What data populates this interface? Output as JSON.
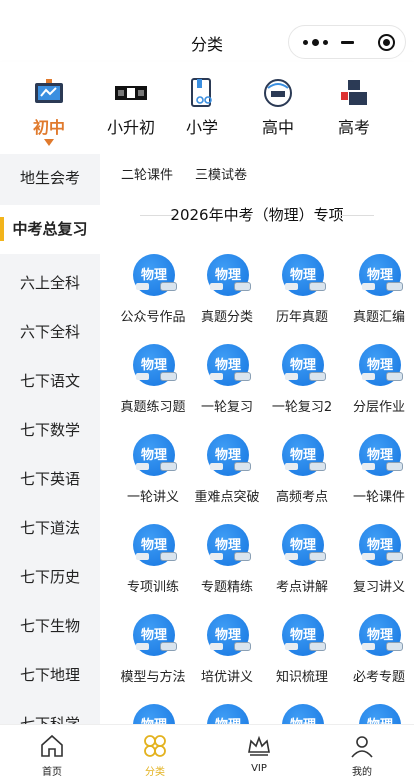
{
  "window": {
    "title": "分类"
  },
  "levels": [
    {
      "label": "初中",
      "icon": "blackboard-icon",
      "active": true
    },
    {
      "label": "小升初",
      "icon": "xiaoshengchu-logo-icon",
      "active": false
    },
    {
      "label": "小学",
      "icon": "book-glasses-icon",
      "active": false
    },
    {
      "label": "高中",
      "icon": "gaozhong-circle-icon",
      "active": false
    },
    {
      "label": "高考",
      "icon": "gaokao-logo-icon",
      "active": false
    }
  ],
  "sidebar": {
    "items": [
      {
        "label": "地生会考",
        "active": false
      },
      {
        "label": "中考总复习",
        "active": true
      },
      {
        "label": "六上全科",
        "active": false
      },
      {
        "label": "六下全科",
        "active": false
      },
      {
        "label": "七下语文",
        "active": false
      },
      {
        "label": "七下数学",
        "active": false
      },
      {
        "label": "七下英语",
        "active": false
      },
      {
        "label": "七下道法",
        "active": false
      },
      {
        "label": "七下历史",
        "active": false
      },
      {
        "label": "七下生物",
        "active": false
      },
      {
        "label": "七下地理",
        "active": false
      },
      {
        "label": "七下科学",
        "active": false
      }
    ]
  },
  "main": {
    "previous_items": [
      "二轮课件",
      "三模试卷"
    ],
    "section_title": "2026年中考（物理）专项",
    "badge_text": "物理",
    "items": [
      "公众号作品",
      "真题分类",
      "历年真题",
      "真题汇编",
      "真题练习题",
      "一轮复习",
      "一轮复习2",
      "分层作业",
      "一轮讲义",
      "重难点突破",
      "高频考点",
      "一轮课件",
      "专项训练",
      "专题精练",
      "考点讲解",
      "复习讲义",
      "模型与方法",
      "培优讲义",
      "知识梳理",
      "必考专题",
      "",
      "",
      "",
      ""
    ]
  },
  "tabbar": [
    {
      "label": "首页",
      "icon": "home-icon",
      "active": false
    },
    {
      "label": "分类",
      "icon": "category-icon",
      "active": true
    },
    {
      "label": "VIP",
      "icon": "crown-icon",
      "active": false
    },
    {
      "label": "我的",
      "icon": "user-icon",
      "active": false
    }
  ],
  "colors": {
    "accent_orange": "#e07a2d",
    "accent_yellow": "#f2b41b",
    "badge_blue": "#1675e0"
  }
}
